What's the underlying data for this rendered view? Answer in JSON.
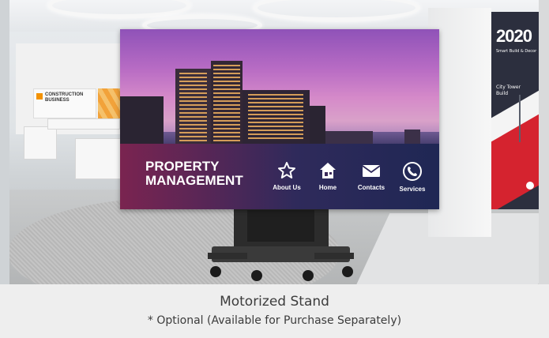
{
  "screen": {
    "headline_line1": "PROPERTY",
    "headline_line2": "MANAGEMENT",
    "nav_items": [
      {
        "label": "About Us",
        "icon": "star-icon"
      },
      {
        "label": "Home",
        "icon": "house-icon"
      },
      {
        "label": "Contacts",
        "icon": "envelope-icon"
      },
      {
        "label": "Services",
        "icon": "phone-icon"
      }
    ]
  },
  "background_signs": {
    "store_sign_line1": "CONSTRUCTION",
    "store_sign_line2": "BUSINESS",
    "banner_year": "2020",
    "banner_subtitle": "Smart Build & Decor",
    "banner_city_line1": "City Tower",
    "banner_city_line2": "Build"
  },
  "caption": {
    "title": "Motorized Stand",
    "subtitle": "* Optional (Available for Purchase Separately)"
  },
  "colors": {
    "panel_left": "#7a2450",
    "panel_right": "#1f2754",
    "caption_bg": "#eeeeee",
    "caption_text": "#3c3c3c"
  }
}
